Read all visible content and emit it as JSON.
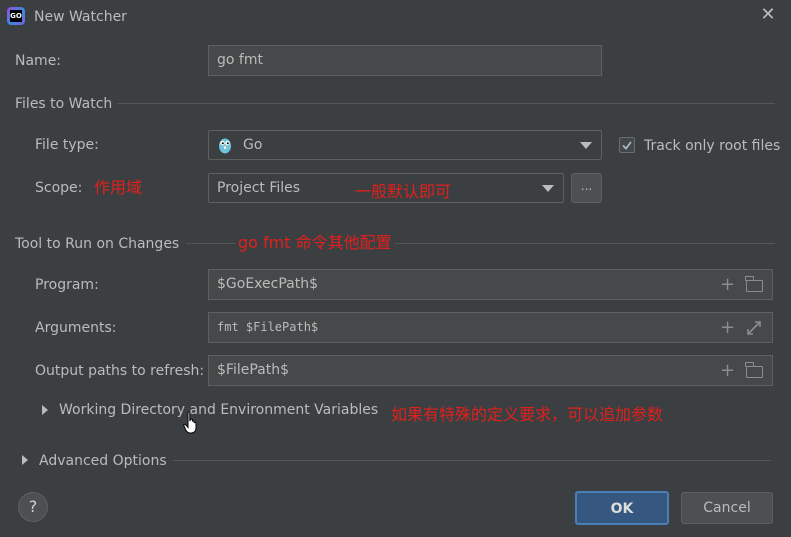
{
  "window": {
    "title": "New Watcher",
    "app_icon_text": "GO",
    "close_glyph": "✕"
  },
  "form": {
    "name_label": "Name:",
    "name_value": "go fmt",
    "files_section": "Files to Watch",
    "file_type_label": "File type:",
    "file_type_value": "Go",
    "track_root_label": "Track only root files",
    "track_root_checked": true,
    "scope_label": "Scope:",
    "scope_value": "Project Files",
    "scope_more": "...",
    "tool_section": "Tool to Run on Changes",
    "program_label": "Program:",
    "program_value": "$GoExecPath$",
    "arguments_label": "Arguments:",
    "arguments_value": "fmt $FilePath$",
    "output_label": "Output paths to refresh:",
    "output_value": "$FilePath$",
    "working_dir_label": "Working Directory and Environment Variables",
    "advanced_label": "Advanced Options"
  },
  "annotations": {
    "scope_note": "作用域",
    "scope_default_note": "一般默认即可",
    "tool_note": "go fmt 命令其他配置",
    "extra_note": "如果有特殊的定义要求，可以追加参数"
  },
  "footer": {
    "help": "?",
    "ok": "OK",
    "cancel": "Cancel"
  },
  "colors": {
    "background": "#3c3f41",
    "field_bg": "#45494a",
    "annotation_red": "#e0201c",
    "ok_button": "#365880"
  }
}
